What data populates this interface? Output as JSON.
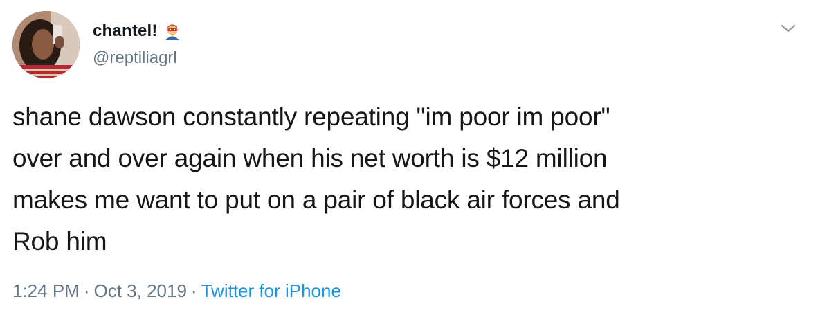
{
  "user": {
    "display_name": "chantel!",
    "name_emoji": "superhero-emoji",
    "handle": "@reptiliagrl"
  },
  "tweet": {
    "lines": [
      "shane dawson constantly repeating \"im poor im poor\"",
      "over and over again when his net worth is $12 million",
      "makes me want to put on a pair of black air forces and",
      "Rob him"
    ]
  },
  "meta": {
    "time": "1:24 PM",
    "separator": "·",
    "date": "Oct 3, 2019",
    "source": "Twitter for iPhone"
  },
  "icons": {
    "caret": "chevron-down-icon"
  },
  "colors": {
    "text": "#14171a",
    "secondary": "#657786",
    "link": "#1b95e0",
    "background": "#ffffff"
  }
}
